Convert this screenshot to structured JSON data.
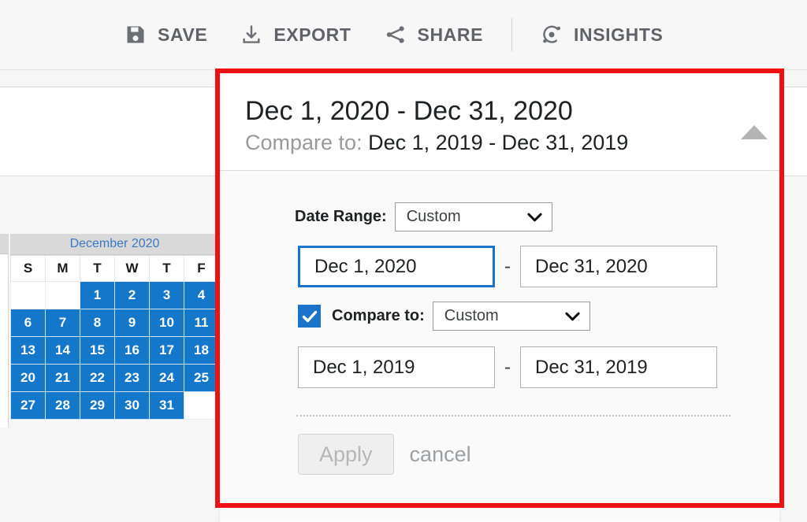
{
  "toolbar": {
    "items": [
      {
        "label": "SAVE",
        "icon": "save-disk-icon"
      },
      {
        "label": "EXPORT",
        "icon": "download-tray-icon"
      },
      {
        "label": "SHARE",
        "icon": "share-nodes-icon"
      },
      {
        "label": "INSIGHTS",
        "icon": "insights-orbit-icon"
      }
    ]
  },
  "annotation": {
    "color": "#ee1111"
  },
  "date_picker": {
    "header": {
      "primary_range": "Dec 1, 2020 - Dec 31, 2020",
      "compare_prefix": "Compare to: ",
      "compare_range": "Dec 1, 2019 - Dec 31, 2019",
      "collapse_icon": "triangle-up-icon"
    },
    "date_range_label": "Date Range:",
    "date_range_value": "Custom",
    "date_range_options": [
      "Custom"
    ],
    "primary_start": "Dec 1, 2020",
    "primary_end": "Dec 31, 2020",
    "range_separator": "-",
    "compare_checked": true,
    "compare_label": "Compare to:",
    "compare_select_value": "Custom",
    "compare_select_options": [
      "Custom"
    ],
    "compare_start": "Dec 1, 2019",
    "compare_end": "Dec 31, 2019",
    "apply_label": "Apply",
    "apply_disabled": true,
    "cancel_label": "cancel",
    "accent_color": "#1a73c8"
  },
  "calendar": {
    "month_label": "December 2020",
    "weekdays": [
      "S",
      "M",
      "T",
      "W",
      "T",
      "F"
    ],
    "selected_color": "#1477c9",
    "next_month_icon": "triangle-right-icon",
    "weeks": [
      [
        {
          "day": "",
          "selected": false
        },
        {
          "day": "",
          "selected": false
        },
        {
          "day": "1",
          "selected": true
        },
        {
          "day": "2",
          "selected": true
        },
        {
          "day": "3",
          "selected": true
        },
        {
          "day": "4",
          "selected": true
        }
      ],
      [
        {
          "day": "6",
          "selected": true
        },
        {
          "day": "7",
          "selected": true
        },
        {
          "day": "8",
          "selected": true
        },
        {
          "day": "9",
          "selected": true
        },
        {
          "day": "10",
          "selected": true
        },
        {
          "day": "11",
          "selected": true
        }
      ],
      [
        {
          "day": "13",
          "selected": true
        },
        {
          "day": "14",
          "selected": true
        },
        {
          "day": "15",
          "selected": true
        },
        {
          "day": "16",
          "selected": true
        },
        {
          "day": "17",
          "selected": true
        },
        {
          "day": "18",
          "selected": true
        }
      ],
      [
        {
          "day": "20",
          "selected": true
        },
        {
          "day": "21",
          "selected": true
        },
        {
          "day": "22",
          "selected": true
        },
        {
          "day": "23",
          "selected": true
        },
        {
          "day": "24",
          "selected": true
        },
        {
          "day": "25",
          "selected": true
        }
      ],
      [
        {
          "day": "27",
          "selected": true
        },
        {
          "day": "28",
          "selected": true
        },
        {
          "day": "29",
          "selected": true
        },
        {
          "day": "30",
          "selected": true
        },
        {
          "day": "31",
          "selected": true
        },
        {
          "day": "",
          "selected": false
        }
      ]
    ]
  }
}
